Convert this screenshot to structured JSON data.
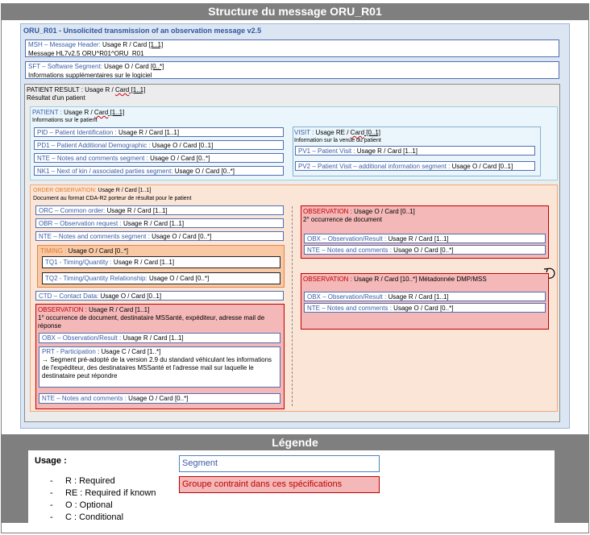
{
  "title": "Structure du message ORU_R01",
  "main": {
    "title": "ORU_R01 - Unsolicited transmission of an observation message v2.5",
    "msh": {
      "code": "MSH – Message Header:",
      "usage": " Usage R / Card ",
      "card": "[1..1]",
      "desc": "Message HL7v2.5 ORU^R01^ORU_R01"
    },
    "sft": {
      "code": "SFT – Software Segment:",
      "usage": " Usage O / Card ",
      "card": "[0..*]",
      "desc": "Informations supplémentaires sur le logiciel"
    },
    "patient_result": {
      "name": "PATIENT RESULT :",
      "usage": " Usage R / ",
      "card_word": "Card",
      "card": " [1..1]",
      "desc": "Résultat d'un patient",
      "patient": {
        "name": "PATIENT :",
        "usage": " Usage R / ",
        "card_word": "Card",
        "card": " [1..1]",
        "desc": "Informations sur le patient",
        "segments": [
          {
            "code": "PID – Patient Identification :",
            "usage": "  Usage R / Card [1..1]"
          },
          {
            "code": "PD1 – Patient Additional Demographic :",
            "usage": "  Usage O / Card [0..1]"
          },
          {
            "code": "NTE – Notes and comments segment :",
            "usage": "  Usage O / Card [0..*]"
          },
          {
            "code": "NK1 – Next of kin / associated parties segment:",
            "usage": "  Usage O / Card [0..*]"
          }
        ],
        "visit": {
          "name": "VISIT :",
          "usage": " Usage RE / ",
          "card_word": "Card",
          "card": " [0..1]",
          "desc": "Information sur la venue du patient",
          "segments": [
            {
              "code": "PV1 – Patient Visit :",
              "usage": " Usage R / Card [1..1]"
            },
            {
              "code": "PV2 – Patient Visit – additional information segment :",
              "usage": " Usage O / Card [0..1]"
            }
          ]
        }
      },
      "order_observation": {
        "name": "ORDER OBSERVATION:",
        "usage": " Usage R / Card [1..1]",
        "desc": "Document au format CDA-R2 porteur de résultat pour le patient",
        "segments": [
          {
            "code": "ORC – Common order:",
            "usage": " Usage R / Card [1..1]"
          },
          {
            "code": "OBR – Observation request :",
            "usage": " Usage R / Card [1..1]"
          },
          {
            "code": "NTE – Notes and comments segment :",
            "usage": "  Usage O / Card [0..*]"
          }
        ],
        "timing": {
          "name": "TIMING :",
          "usage": " Usage O / Card [0..*]",
          "segments": [
            {
              "code": "TQ1 - Timing/Quantity :",
              "usage": " Usage R / Card [1..1]"
            },
            {
              "code": "TQ2 - Timing/Quantity Relationship:",
              "usage": " Usage O / Card [0..*]"
            }
          ]
        },
        "ctd": {
          "code": "CTD – Contact Data:",
          "usage": "  Usage O / Card [0..1]"
        },
        "observation1": {
          "name": "OBSERVATION :",
          "usage": " Usage R / Card [1..1]",
          "desc": "1° occurrence de document, destinataire MSSanté, expéditeur, adresse mail de réponse",
          "obx": {
            "code": "OBX – Observation/Result :",
            "usage": " Usage R / Card [1..1]"
          },
          "prt": {
            "code": "PRT - Participation",
            "usage": " : Usage C / Card [1..*]",
            "desc": "→ Segment pré-adopté de la version 2.9 du standard véhiculant les informations de l'expéditeur, des destinataires MSSanté et l'adresse mail sur laquelle le destinataire peut répondre"
          },
          "nte": {
            "code": "NTE – Notes and comments :",
            "usage": " Usage O / Card [0..*]"
          }
        },
        "observation2": {
          "name": "OBSERVATION :",
          "usage": " Usage O / Card [0..1]",
          "desc": "2° occurrence de document",
          "obx": {
            "code": "OBX – Observation/Result :",
            "usage": " Usage R / Card [1..1]"
          },
          "nte": {
            "code": "NTE – Notes and comments :",
            "usage": " Usage O / Card [0..*]"
          }
        },
        "observation3": {
          "name": "OBSERVATION :",
          "usage": " Usage R / Card [10..*] Métadonnée DMP/MSS",
          "obx": {
            "code": "OBX – Observation/Result :",
            "usage": " Usage R / Card [1..1]"
          },
          "nte": {
            "code": "NTE – Notes and comments :",
            "usage": " Usage O / Card [0..*]"
          }
        }
      }
    }
  },
  "legend": {
    "title": "Légende",
    "usage_label": "Usage :",
    "items": [
      "R : Required",
      "RE : Required if known",
      "O : Optional",
      "C : Conditional"
    ],
    "segment_label": "Segment",
    "group_label": "Groupe contraint dans ces spécifications"
  },
  "icons": {
    "loop": "loop-arrow-icon"
  },
  "colors": {
    "header_bar": "#7f7f7f",
    "main_bg": "#dce6f2",
    "patient_result_bg": "#ececec",
    "patient_bg": "#eaf6fb",
    "order_bg": "#fbe5d6",
    "timing_bg": "#f9c9a6",
    "observation_bg": "#f4b8b8",
    "segment_border": "#4f6fb0",
    "group_border": "#c00000"
  }
}
